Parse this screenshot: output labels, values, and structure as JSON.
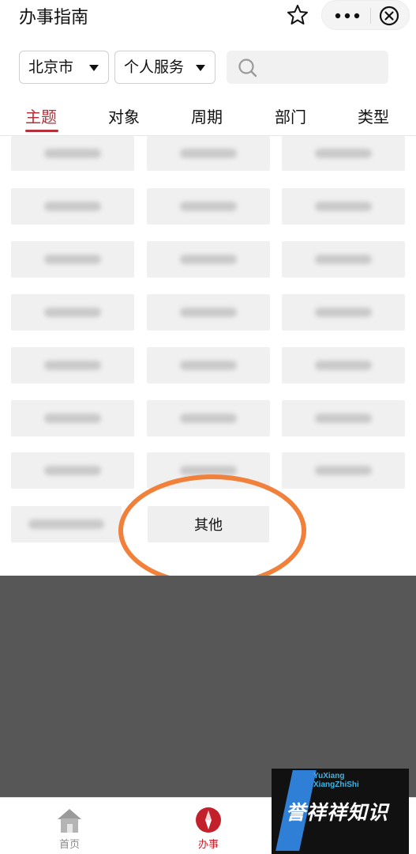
{
  "header": {
    "title": "办事指南"
  },
  "filters": {
    "city": "北京市",
    "service": "个人服务",
    "search_placeholder": ""
  },
  "tabs": [
    {
      "label": "主题",
      "active": true
    },
    {
      "label": "对象",
      "active": false
    },
    {
      "label": "周期",
      "active": false
    },
    {
      "label": "部门",
      "active": false
    },
    {
      "label": "类型",
      "active": false
    }
  ],
  "grid": {
    "visible_item": "其他",
    "blurred_item_count": 21
  },
  "colors": {
    "accent": "#b5303a",
    "highlight_ring": "#f0803a",
    "overlay": "#575757"
  },
  "bottom_nav": [
    {
      "label": "首页",
      "icon": "home-icon",
      "active": false
    },
    {
      "label": "办事",
      "icon": "compass-icon",
      "active": true
    }
  ],
  "watermark": {
    "line1": "YuXiang",
    "line2": "XiangZhiShi",
    "main": "誉祥祥知识"
  }
}
